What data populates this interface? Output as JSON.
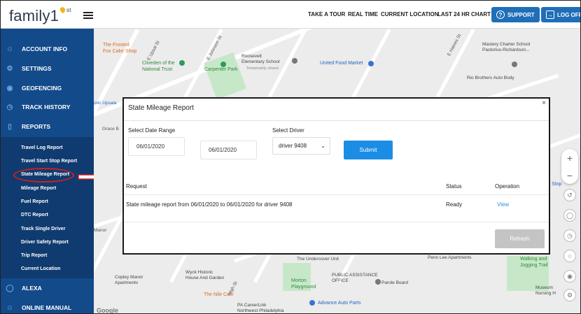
{
  "header": {
    "logo_text": "family1",
    "logo_sup": "st",
    "nav": [
      "TAKE A TOUR",
      "REAL TIME",
      "CURRENT LOCATION",
      "LAST 24 HR CHART"
    ],
    "support_label": "SUPPORT",
    "logoff_label": "LOG OFF",
    "support_icon": "?",
    "logoff_icon": "→",
    "accent": "#1f6fb8"
  },
  "sidebar": {
    "bg": "#134a8a",
    "items": [
      {
        "label": "ACCOUNT INFO",
        "icon": "user-icon"
      },
      {
        "label": "SETTINGS",
        "icon": "gear-icon"
      },
      {
        "label": "GEOFENCING",
        "icon": "geofence-icon"
      },
      {
        "label": "TRACK HISTORY",
        "icon": "history-icon"
      },
      {
        "label": "REPORTS",
        "icon": "phone-icon"
      }
    ],
    "reports": [
      "Travel Log Report",
      "Travel Start Stop Report",
      "State Mileage Report",
      "Mileage Report",
      "Fuel Report",
      "DTC Report",
      "Track Single Driver",
      "Driver Safety Report",
      "Trip Report",
      "Current Location"
    ],
    "bottom_items": [
      {
        "label": "ALEXA",
        "icon": "alexa-icon"
      },
      {
        "label": "ONLINE MANUAL",
        "icon": "user-icon"
      }
    ]
  },
  "map": {
    "labels": {
      "frosted_fox": "The Frosted\nFox Cake Shop",
      "cliveden": "Cliveden of the\nNational Trust",
      "carpenter": "Carpenter Park",
      "roosevelt": "Roosevelt\nElementary School",
      "temp_closed": "Temporarily closed",
      "united_food": "United Food Market",
      "mastery": "Mastery Charter School\nPastorius-Richardson...",
      "rio": "Rio Brothers Auto Body",
      "upsala": "oric Upsala",
      "grace": "Grace B",
      "manor": "Manor",
      "copley": "Copley Manor\nApartments",
      "wyck": "Wyck Historic\nHouse And Garden",
      "nile": "The Nile Cafe",
      "morton": "Morton\nPlayground",
      "undercover": "The Undercover Unit",
      "public_assistance": "PUBLIC ASSISTANCE\nOFFICE",
      "parole": "Parole Board",
      "advance": "Advance Auto Parts",
      "careerlink": "PA CareerLink\nNorthwest Philadelphia",
      "penn_lee": "Penn Lee Apartments",
      "walking": "Walking and\nJogging Trail",
      "museum": "Museum\nNursing H",
      "stop": "Stop",
      "google": "Google",
      "e_upsal": "E Upsal St",
      "e_johnson": "E Johnson St",
      "e_haines": "E Haines St",
      "high_st": "High St"
    }
  },
  "modal": {
    "title": "State Mileage Report",
    "close": "×",
    "date_label": "Select Date Range",
    "date_from": "06/01/2020",
    "date_to": "06/01/2020",
    "driver_label": "Select Driver",
    "driver_value": "driver 9408",
    "submit_label": "Submit",
    "columns": [
      "Request",
      "Status",
      "Operation"
    ],
    "rows": [
      {
        "request": "State mileage report from 06/01/2020 to 06/01/2020 for driver 9408",
        "status": "Ready",
        "operation": "View"
      }
    ],
    "refresh_label": "Refresh"
  }
}
